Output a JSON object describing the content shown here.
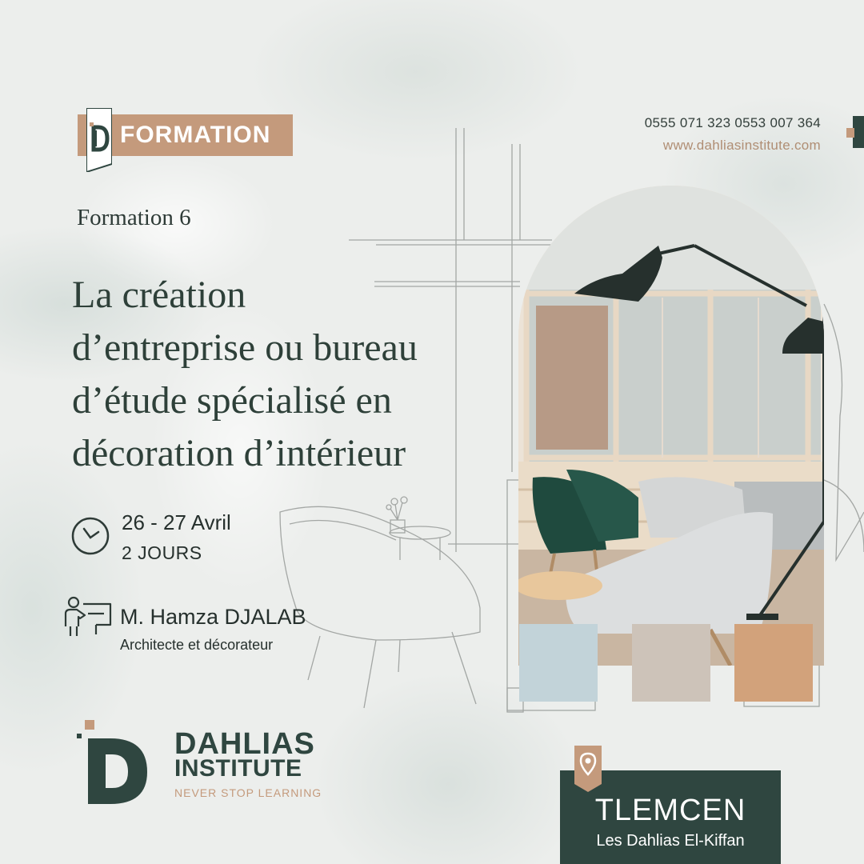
{
  "header": {
    "tag_label": "FORMATION",
    "phones": "0555 071 323  0553 007 364",
    "website": "www.dahliasinstitute.com"
  },
  "course": {
    "number": "Formation 6",
    "title_lines": [
      "La création",
      "d’entreprise ou bureau",
      "d’étude spécialisé en",
      "décoration d’intérieur"
    ],
    "date": "26 - 27 Avril",
    "duration": "2 JOURS"
  },
  "trainer": {
    "name": "M. Hamza DJALAB",
    "role": "Architecte et décorateur"
  },
  "logo": {
    "line1": "DAHLIAS",
    "line2": "INSTITUTE",
    "tagline": "NEVER STOP LEARNING"
  },
  "location": {
    "city": "TLEMCEN",
    "area": "Les Dahlias El-Kiffan"
  },
  "palette": {
    "dark_green": "#2f4640",
    "accent_tan": "#c49a7c",
    "swatches": [
      "#c2d3d9",
      "#cdc3b9",
      "#d2a27b"
    ]
  },
  "icons": [
    "clock-icon",
    "trainer-icon",
    "location-pin-icon",
    "logo-mark"
  ]
}
